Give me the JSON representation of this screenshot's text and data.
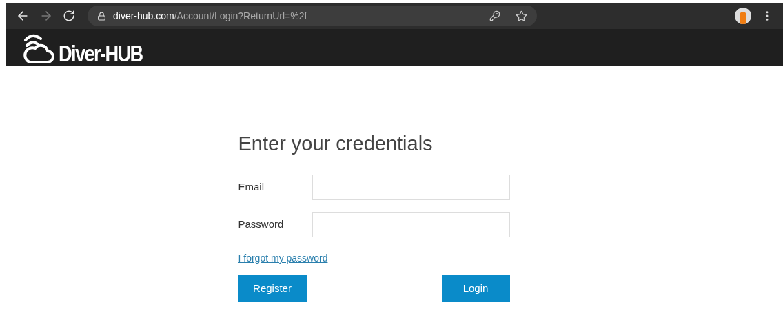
{
  "browser": {
    "url_domain": "diver-hub.com",
    "url_path": "/Account/Login?ReturnUrl=%2f",
    "forward_disabled": true
  },
  "site": {
    "logo_text": "Diver-HUB"
  },
  "form": {
    "title": "Enter your credentials",
    "fields": [
      {
        "label": "Email"
      },
      {
        "label": "Password"
      }
    ],
    "forgot_link": "I forgot my password",
    "buttons": [
      {
        "label": "Register"
      },
      {
        "label": "Login"
      }
    ]
  }
}
